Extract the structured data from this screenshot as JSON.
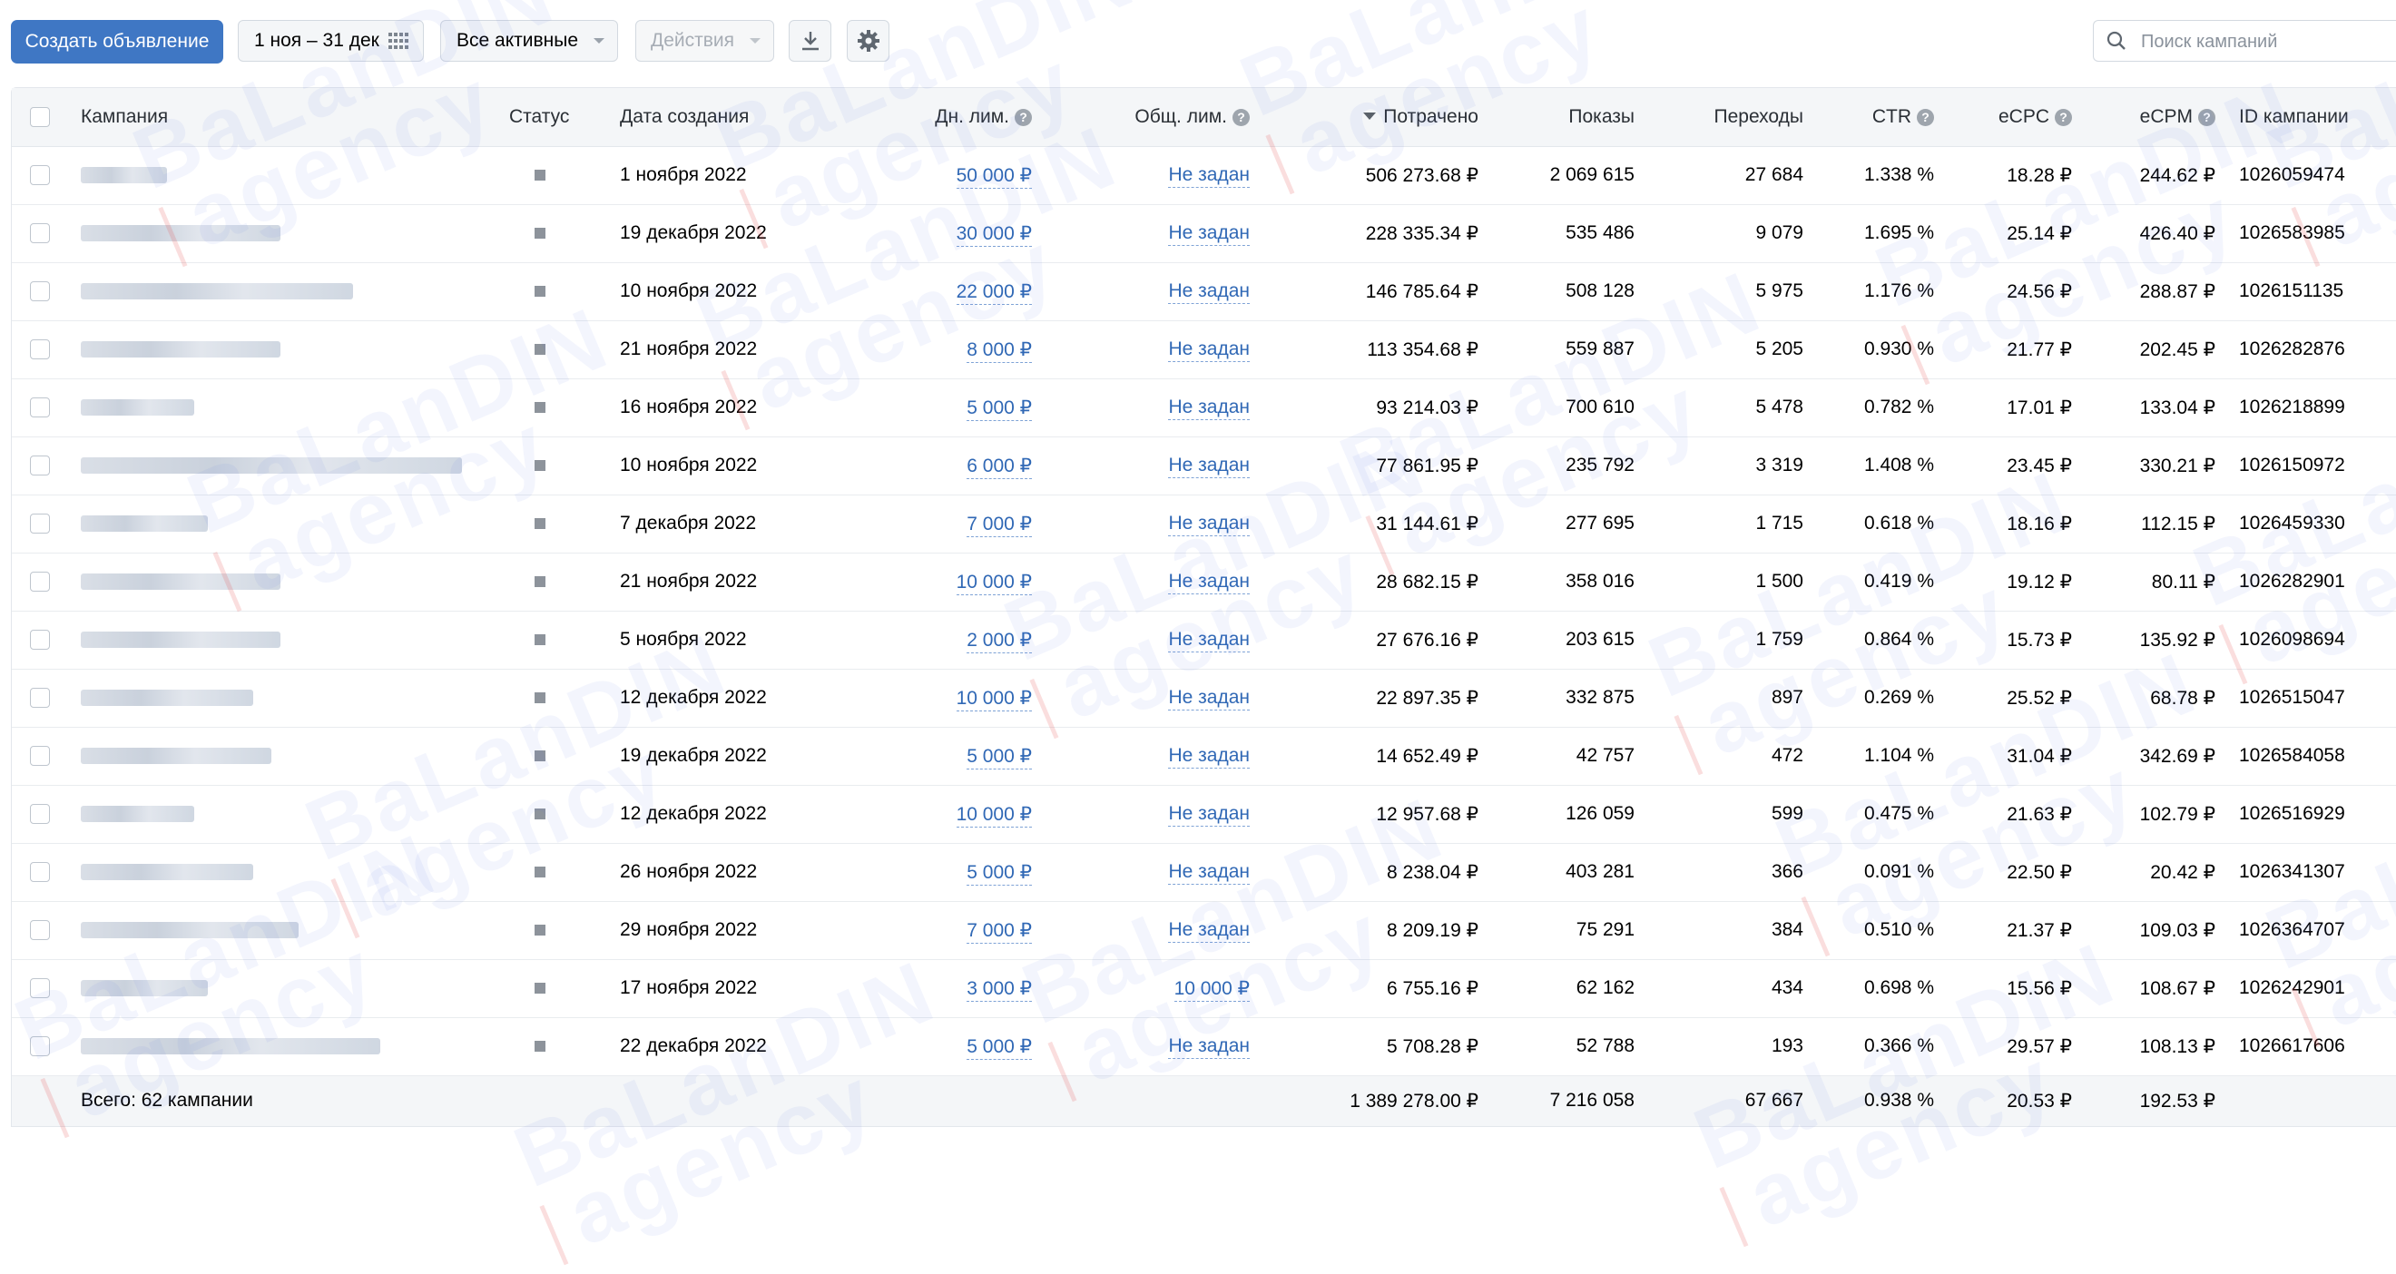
{
  "toolbar": {
    "create_label": "Создать объявление",
    "date_range": "1 ноя – 31 дек",
    "filter_label": "Все активные",
    "actions_label": "Действия",
    "icons": {
      "calendar": "grid-calendar-icon",
      "download": "download-icon",
      "settings": "gear-icon",
      "search": "search-icon"
    }
  },
  "search": {
    "placeholder": "Поиск кампаний"
  },
  "columns": {
    "campaign": "Кампания",
    "status": "Статус",
    "created": "Дата создания",
    "daily_limit": "Дн. лим.",
    "total_limit": "Общ. лим.",
    "spent": "Потрачено",
    "impressions": "Показы",
    "clicks": "Переходы",
    "ctr": "CTR",
    "ecpc": "eCPC",
    "ecpm": "eCPM",
    "campaign_id": "ID кампании"
  },
  "rows": [
    {
      "created": "1 ноября 2022",
      "daily": "50 000 ₽",
      "total": "Не задан",
      "spent": "506 273.68 ₽",
      "impressions": "2 069 615",
      "clicks": "27 684",
      "ctr": "1.338 %",
      "ecpc": "18.28 ₽",
      "ecpm": "244.62 ₽",
      "id": "1026059474"
    },
    {
      "created": "19 декабря 2022",
      "daily": "30 000 ₽",
      "total": "Не задан",
      "spent": "228 335.34 ₽",
      "impressions": "535 486",
      "clicks": "9 079",
      "ctr": "1.695 %",
      "ecpc": "25.14 ₽",
      "ecpm": "426.40 ₽",
      "id": "1026583985"
    },
    {
      "created": "10 ноября 2022",
      "daily": "22 000 ₽",
      "total": "Не задан",
      "spent": "146 785.64 ₽",
      "impressions": "508 128",
      "clicks": "5 975",
      "ctr": "1.176 %",
      "ecpc": "24.56 ₽",
      "ecpm": "288.87 ₽",
      "id": "1026151135"
    },
    {
      "created": "21 ноября 2022",
      "daily": "8 000 ₽",
      "total": "Не задан",
      "spent": "113 354.68 ₽",
      "impressions": "559 887",
      "clicks": "5 205",
      "ctr": "0.930 %",
      "ecpc": "21.77 ₽",
      "ecpm": "202.45 ₽",
      "id": "1026282876"
    },
    {
      "created": "16 ноября 2022",
      "daily": "5 000 ₽",
      "total": "Не задан",
      "spent": "93 214.03 ₽",
      "impressions": "700 610",
      "clicks": "5 478",
      "ctr": "0.782 %",
      "ecpc": "17.01 ₽",
      "ecpm": "133.04 ₽",
      "id": "1026218899"
    },
    {
      "created": "10 ноября 2022",
      "daily": "6 000 ₽",
      "total": "Не задан",
      "spent": "77 861.95 ₽",
      "impressions": "235 792",
      "clicks": "3 319",
      "ctr": "1.408 %",
      "ecpc": "23.45 ₽",
      "ecpm": "330.21 ₽",
      "id": "1026150972"
    },
    {
      "created": "7 декабря 2022",
      "daily": "7 000 ₽",
      "total": "Не задан",
      "spent": "31 144.61 ₽",
      "impressions": "277 695",
      "clicks": "1 715",
      "ctr": "0.618 %",
      "ecpc": "18.16 ₽",
      "ecpm": "112.15 ₽",
      "id": "1026459330"
    },
    {
      "created": "21 ноября 2022",
      "daily": "10 000 ₽",
      "total": "Не задан",
      "spent": "28 682.15 ₽",
      "impressions": "358 016",
      "clicks": "1 500",
      "ctr": "0.419 %",
      "ecpc": "19.12 ₽",
      "ecpm": "80.11 ₽",
      "id": "1026282901"
    },
    {
      "created": "5 ноября 2022",
      "daily": "2 000 ₽",
      "total": "Не задан",
      "spent": "27 676.16 ₽",
      "impressions": "203 615",
      "clicks": "1 759",
      "ctr": "0.864 %",
      "ecpc": "15.73 ₽",
      "ecpm": "135.92 ₽",
      "id": "1026098694"
    },
    {
      "created": "12 декабря 2022",
      "daily": "10 000 ₽",
      "total": "Не задан",
      "spent": "22 897.35 ₽",
      "impressions": "332 875",
      "clicks": "897",
      "ctr": "0.269 %",
      "ecpc": "25.52 ₽",
      "ecpm": "68.78 ₽",
      "id": "1026515047"
    },
    {
      "created": "19 декабря 2022",
      "daily": "5 000 ₽",
      "total": "Не задан",
      "spent": "14 652.49 ₽",
      "impressions": "42 757",
      "clicks": "472",
      "ctr": "1.104 %",
      "ecpc": "31.04 ₽",
      "ecpm": "342.69 ₽",
      "id": "1026584058"
    },
    {
      "created": "12 декабря 2022",
      "daily": "10 000 ₽",
      "total": "Не задан",
      "spent": "12 957.68 ₽",
      "impressions": "126 059",
      "clicks": "599",
      "ctr": "0.475 %",
      "ecpc": "21.63 ₽",
      "ecpm": "102.79 ₽",
      "id": "1026516929"
    },
    {
      "created": "26 ноября 2022",
      "daily": "5 000 ₽",
      "total": "Не задан",
      "spent": "8 238.04 ₽",
      "impressions": "403 281",
      "clicks": "366",
      "ctr": "0.091 %",
      "ecpc": "22.50 ₽",
      "ecpm": "20.42 ₽",
      "id": "1026341307"
    },
    {
      "created": "29 ноября 2022",
      "daily": "7 000 ₽",
      "total": "Не задан",
      "spent": "8 209.19 ₽",
      "impressions": "75 291",
      "clicks": "384",
      "ctr": "0.510 %",
      "ecpc": "21.37 ₽",
      "ecpm": "109.03 ₽",
      "id": "1026364707"
    },
    {
      "created": "17 ноября 2022",
      "daily": "3 000 ₽",
      "total": "10 000 ₽",
      "spent": "6 755.16 ₽",
      "impressions": "62 162",
      "clicks": "434",
      "ctr": "0.698 %",
      "ecpc": "15.56 ₽",
      "ecpm": "108.67 ₽",
      "id": "1026242901"
    },
    {
      "created": "22 декабря 2022",
      "daily": "5 000 ₽",
      "total": "Не задан",
      "spent": "5 708.28 ₽",
      "impressions": "52 788",
      "clicks": "193",
      "ctr": "0.366 %",
      "ecpc": "29.57 ₽",
      "ecpm": "108.13 ₽",
      "id": "1026617606"
    }
  ],
  "totals": {
    "label": "Всего: 62 кампании",
    "spent": "1 389 278.00 ₽",
    "impressions": "7 216 058",
    "clicks": "67 667",
    "ctr": "0.938 %",
    "ecpc": "20.53 ₽",
    "ecpm": "192.53 ₽"
  },
  "watermark": {
    "line1": "BaLanDIN",
    "line2": "agency"
  }
}
